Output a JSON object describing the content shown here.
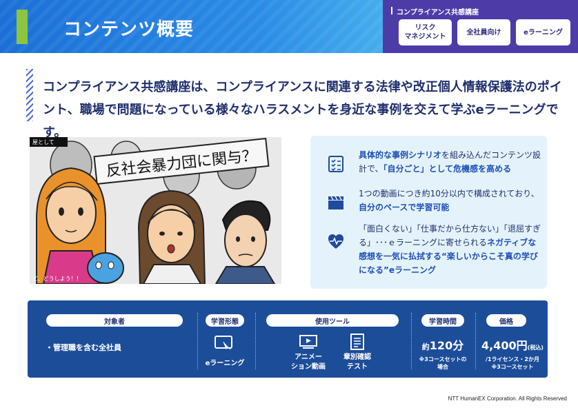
{
  "header": {
    "title": "コンテンツ概要",
    "course_title": "コンプライアンス共感講座",
    "tags": [
      "リスク\nマネジメント",
      "全社員向け",
      "eラーニング"
    ]
  },
  "lead": {
    "line1": "コンプライアンス共感講座は、コンプライアンスに関連する法律や改正個人情報保護法のポイ",
    "line2": "ント、職場で問題になっている様々なハラスメントを身近な事例を交えて学ぶeラーニングです。"
  },
  "illustration": {
    "sign_text": "反社会暴力団に関与？",
    "corner_text": "屋として",
    "caption": "ど、どうしよう！！"
  },
  "features": [
    {
      "icon": "checklist-icon",
      "parts": [
        {
          "t": "具体的な事例シナリオ",
          "h": true
        },
        {
          "t": "を組み込んだコンテンツ設計で、",
          "h": false
        },
        {
          "t": "「自分ごと」として危機感を高める",
          "h": true
        }
      ]
    },
    {
      "icon": "clapperboard-icon",
      "parts": [
        {
          "t": "1つの動画につき約10分以内で構成されており、",
          "h": false
        },
        {
          "t": "自分のペースで学習可能",
          "h": true
        }
      ]
    },
    {
      "icon": "heart-pulse-icon",
      "parts": [
        {
          "t": "「面白くない」「仕事だから仕方ない」「退屈すぎる」･･･ｅラーニングに寄せられる",
          "h": false
        },
        {
          "t": "ネガティブな感想を一気に払拭する“楽しいからこそ真の学びになる”eラーニング",
          "h": true
        }
      ]
    }
  ],
  "info": {
    "target_label": "対象者",
    "target_value": "・管理職を含む全社員",
    "format_label": "学習形態",
    "format_value": "eラーニング",
    "tools_label": "使用ツール",
    "tool1": "アニメー\nション動画",
    "tool2": "章別確認\nテスト",
    "time_label": "学習時間",
    "time_prefix": "約",
    "time_value": "120分",
    "time_note": "※3コースセットの\n場合",
    "price_label": "価格",
    "price_value": "4,400円",
    "price_tax": "(税込)",
    "price_note": "/1ライセンス・2か月\n※3コースセット"
  },
  "footer": "NTT HumanEX Corporation. All Rights Reserved",
  "colors": {
    "header_blue": "#2a8ce6",
    "course_purple": "#4d3ca8",
    "accent_green": "#8cc63f",
    "navy": "#1c4d99",
    "highlight": "#1d4fb8",
    "panel_bg": "#e4f3fb"
  }
}
